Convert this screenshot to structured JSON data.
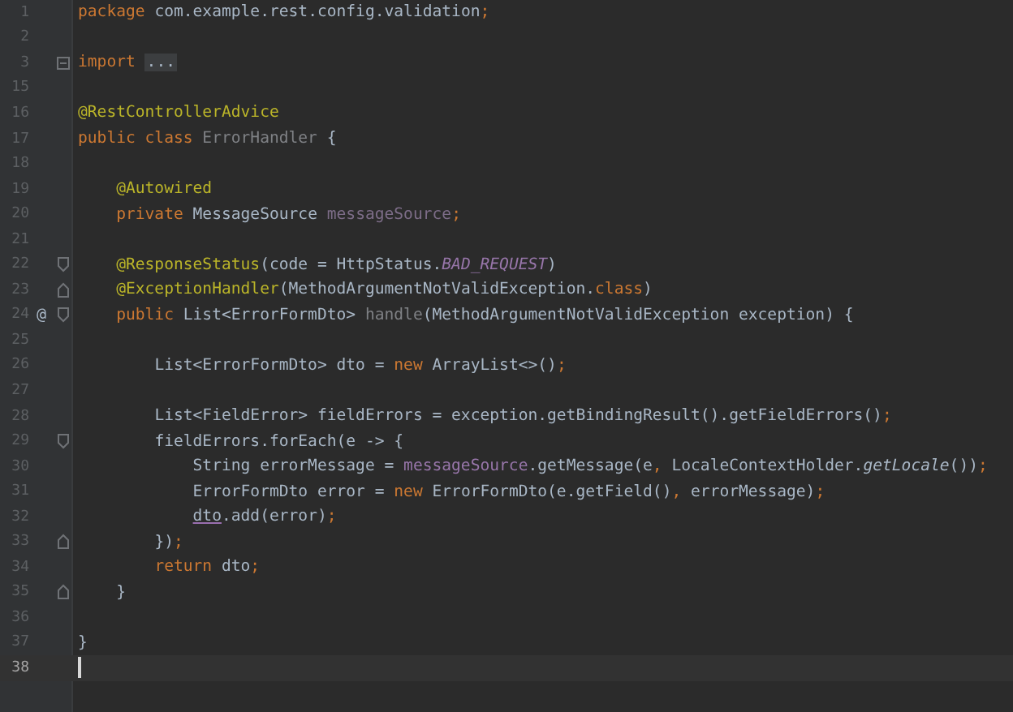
{
  "editor": {
    "lines": [
      {
        "number": "1",
        "tokens": [
          {
            "text": "package",
            "kind": "keyword"
          },
          {
            "text": " com.example.rest.config.validation",
            "kind": "plain"
          },
          {
            "text": ";",
            "kind": "keyword"
          }
        ]
      },
      {
        "number": "2"
      },
      {
        "number": "3",
        "folded": true,
        "tokens": [
          {
            "text": "import",
            "kind": "keyword"
          },
          {
            "text": " ...",
            "kind": "folded"
          }
        ]
      },
      {
        "number": "15"
      },
      {
        "number": "16",
        "tokens": [
          {
            "text": "@RestControllerAdvice",
            "kind": "annotation"
          }
        ]
      },
      {
        "number": "17",
        "tokens": [
          {
            "text": "public class",
            "kind": "keyword"
          },
          {
            "text": " ErrorHandler",
            "kind": "unused"
          },
          {
            "text": " {",
            "kind": "plain"
          }
        ]
      },
      {
        "number": "18"
      },
      {
        "number": "19",
        "tokens": [
          {
            "text": "    @Autowired",
            "kind": "annotation"
          }
        ]
      },
      {
        "number": "20",
        "tokens": [
          {
            "text": "    private",
            "kind": "keyword"
          },
          {
            "text": " MessageSource ",
            "kind": "plain"
          },
          {
            "text": "messageSource",
            "kind": "unused-field"
          },
          {
            "text": ";",
            "kind": "keyword"
          }
        ]
      },
      {
        "number": "21"
      },
      {
        "number": "22",
        "fold_open": true,
        "tokens": [
          {
            "text": "    @ResponseStatus",
            "kind": "annotation"
          },
          {
            "text": "(code = HttpStatus.",
            "kind": "plain"
          },
          {
            "text": "BAD_REQUEST",
            "kind": "static"
          },
          {
            "text": ")",
            "kind": "plain"
          }
        ]
      },
      {
        "number": "23",
        "fold_close": true,
        "tokens": [
          {
            "text": "    @ExceptionHandler",
            "kind": "annotation"
          },
          {
            "text": "(MethodArgumentNotValidException.",
            "kind": "plain"
          },
          {
            "text": "class",
            "kind": "keyword"
          },
          {
            "text": ")",
            "kind": "plain"
          }
        ]
      },
      {
        "number": "24",
        "marker": "@",
        "fold_open": true,
        "tokens": [
          {
            "text": "    public",
            "kind": "keyword"
          },
          {
            "text": " List<ErrorFormDto> ",
            "kind": "plain"
          },
          {
            "text": "handle",
            "kind": "unused"
          },
          {
            "text": "(MethodArgumentNotValidException exception) {",
            "kind": "plain"
          }
        ]
      },
      {
        "number": "25"
      },
      {
        "number": "26",
        "tokens": [
          {
            "text": "        List<ErrorFormDto> dto = ",
            "kind": "plain"
          },
          {
            "text": "new",
            "kind": "keyword"
          },
          {
            "text": " ArrayList<>()",
            "kind": "plain"
          },
          {
            "text": ";",
            "kind": "keyword"
          }
        ]
      },
      {
        "number": "27"
      },
      {
        "number": "28",
        "tokens": [
          {
            "text": "        List<FieldError> fieldErrors = exception.getBindingResult().getFieldErrors()",
            "kind": "plain"
          },
          {
            "text": ";",
            "kind": "keyword"
          }
        ]
      },
      {
        "number": "29",
        "fold_open": true,
        "tokens": [
          {
            "text": "        fieldErrors.forEach(e -> {",
            "kind": "plain"
          }
        ]
      },
      {
        "number": "30",
        "tokens": [
          {
            "text": "            String errorMessage = ",
            "kind": "plain"
          },
          {
            "text": "messageSource",
            "kind": "field"
          },
          {
            "text": ".getMessage(e",
            "kind": "plain"
          },
          {
            "text": ",",
            "kind": "keyword"
          },
          {
            "text": " LocaleContextHolder.",
            "kind": "plain"
          },
          {
            "text": "getLocale",
            "kind": "static-method"
          },
          {
            "text": "())",
            "kind": "plain"
          },
          {
            "text": ";",
            "kind": "keyword"
          }
        ]
      },
      {
        "number": "31",
        "tokens": [
          {
            "text": "            ErrorFormDto error = ",
            "kind": "plain"
          },
          {
            "text": "new",
            "kind": "keyword"
          },
          {
            "text": " ErrorFormDto(e.getField()",
            "kind": "plain"
          },
          {
            "text": ",",
            "kind": "keyword"
          },
          {
            "text": " errorMessage)",
            "kind": "plain"
          },
          {
            "text": ";",
            "kind": "keyword"
          }
        ]
      },
      {
        "number": "32",
        "tokens": [
          {
            "text": "            dto",
            "kind": "underlined"
          },
          {
            "text": ".add(error)",
            "kind": "plain"
          },
          {
            "text": ";",
            "kind": "keyword"
          }
        ]
      },
      {
        "number": "33",
        "fold_close": true,
        "tokens": [
          {
            "text": "        })",
            "kind": "plain"
          },
          {
            "text": ";",
            "kind": "keyword"
          }
        ]
      },
      {
        "number": "34",
        "tokens": [
          {
            "text": "        return",
            "kind": "keyword"
          },
          {
            "text": " dto",
            "kind": "plain"
          },
          {
            "text": ";",
            "kind": "keyword"
          }
        ]
      },
      {
        "number": "35",
        "fold_close": true,
        "tokens": [
          {
            "text": "    }",
            "kind": "plain"
          }
        ]
      },
      {
        "number": "36"
      },
      {
        "number": "37",
        "tokens": [
          {
            "text": "}",
            "kind": "plain"
          }
        ]
      },
      {
        "number": "38",
        "current": true,
        "cursor": true
      }
    ]
  }
}
